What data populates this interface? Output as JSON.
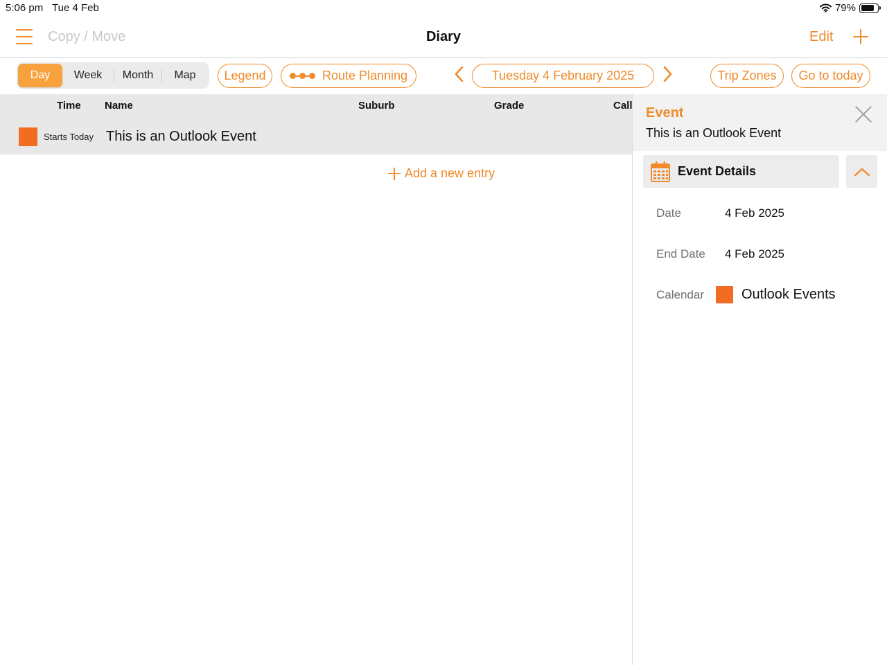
{
  "status_bar": {
    "time": "5:06 pm",
    "date": "Tue 4 Feb",
    "battery": "79%",
    "battery_level": 0.79
  },
  "nav": {
    "copy_move": "Copy / Move",
    "title": "Diary",
    "edit": "Edit"
  },
  "toolbar": {
    "view_tabs": [
      "Day",
      "Week",
      "Month",
      "Map"
    ],
    "selected_view": "Day",
    "legend": "Legend",
    "route_planning": "Route Planning",
    "current_date": "Tuesday 4 February 2025",
    "trip_zones": "Trip Zones",
    "go_to_today": "Go to today"
  },
  "table": {
    "columns": [
      "Time",
      "Name",
      "Suburb",
      "Grade",
      "Call"
    ],
    "rows": [
      {
        "time": "Starts Today",
        "name": "This is an Outlook Event",
        "color": "#F26C22"
      }
    ],
    "add_entry": "Add a new entry"
  },
  "detail": {
    "type": "Event",
    "title": "This is an Outlook Event",
    "section_title": "Event Details",
    "fields": [
      {
        "label": "Date",
        "value": "4 Feb 2025"
      },
      {
        "label": "End Date",
        "value": "4 Feb 2025"
      }
    ],
    "calendar_label": "Calendar",
    "calendar_name": "Outlook Events",
    "calendar_color": "#F26C22"
  },
  "colors": {
    "accent": "#F08A2A",
    "segment_active": "#F7A23F",
    "event_color": "#F26C22"
  }
}
